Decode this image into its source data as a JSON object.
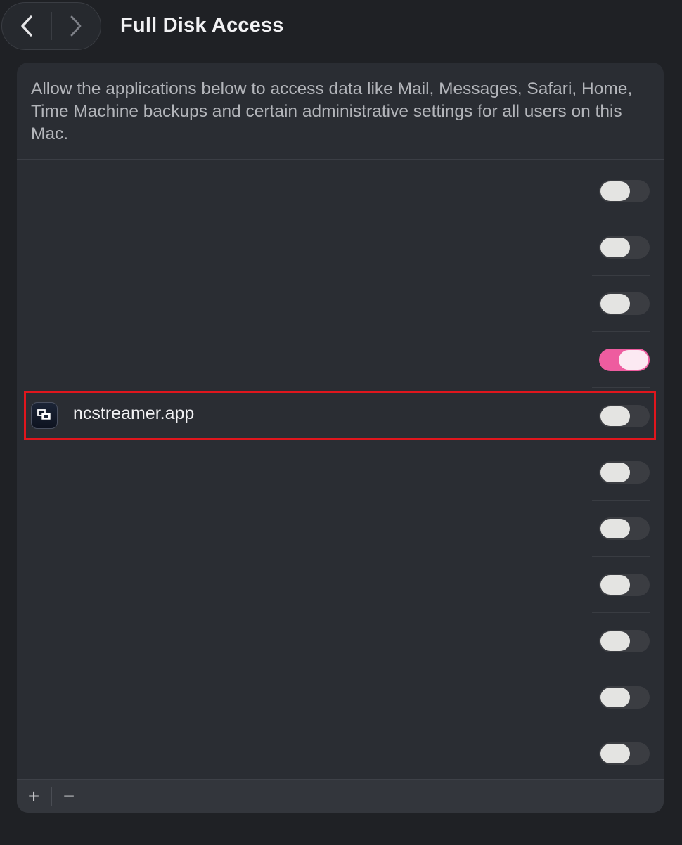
{
  "header": {
    "title": "Full Disk Access",
    "back_icon": "chevron-left-icon",
    "forward_icon": "chevron-right-icon"
  },
  "description": "Allow the applications below to access data like Mail, Messages, Safari, Home, Time Machine backups and certain administrative settings for all users on this Mac.",
  "apps": [
    {
      "name": "",
      "enabled": false
    },
    {
      "name": "",
      "enabled": false
    },
    {
      "name": "",
      "enabled": false
    },
    {
      "name": "",
      "enabled": true
    },
    {
      "name": "ncstreamer.app",
      "enabled": false,
      "icon": "ncstreamer-app-icon",
      "highlighted": true
    },
    {
      "name": "",
      "enabled": false
    },
    {
      "name": "",
      "enabled": false
    },
    {
      "name": "",
      "enabled": false
    },
    {
      "name": "",
      "enabled": false
    },
    {
      "name": "",
      "enabled": false
    },
    {
      "name": "",
      "enabled": false
    }
  ],
  "footer": {
    "add_label": "+",
    "remove_label": "−"
  },
  "colors": {
    "toggle_on": "#ee5c9f",
    "highlight": "#e0161d",
    "background": "#1f2125",
    "card": "#2a2d33"
  }
}
